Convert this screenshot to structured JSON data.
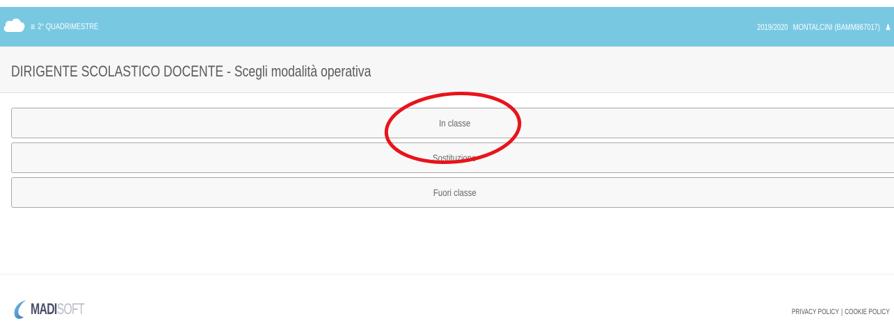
{
  "navbar": {
    "period_label": "2° QUADRIMESTRE",
    "year": "2019/2020",
    "school": "MONTALCINI (BAMM867017)",
    "background": "#78c8e2"
  },
  "page": {
    "title": "DIRIGENTE SCOLASTICO DOCENTE - Scegli modalità operativa"
  },
  "modes": [
    {
      "label": "In classe"
    },
    {
      "label": "Sostituzione"
    },
    {
      "label": "Fuori classe"
    }
  ],
  "annotation": {
    "color": "#e8141a",
    "target": "In classe"
  },
  "footer": {
    "logo_bold": "MADI",
    "logo_light": "SOFT",
    "privacy": "PRIVACY POLICY",
    "separator": "|",
    "cookie": "COOKIE POLICY"
  }
}
